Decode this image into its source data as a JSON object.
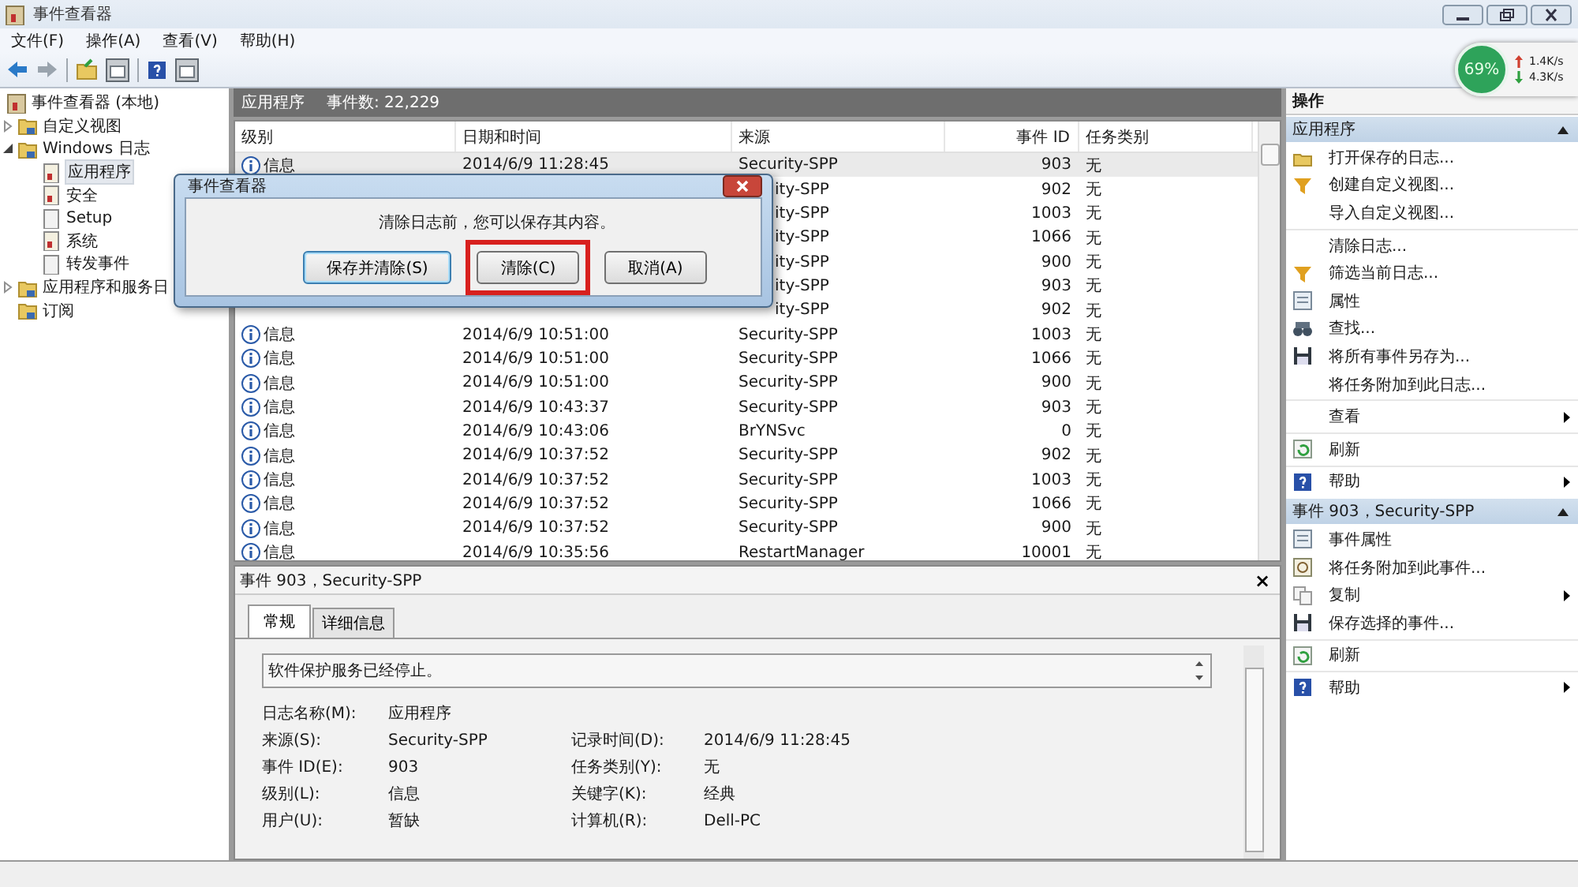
{
  "window": {
    "title": "事件查看器"
  },
  "menu": [
    "文件(F)",
    "操作(A)",
    "查看(V)",
    "帮助(H)"
  ],
  "network_widget": {
    "percent": "69%",
    "upload": "1.4K/s",
    "download": "4.3K/s"
  },
  "tree": [
    {
      "label": "事件查看器 (本地)",
      "kind": "root",
      "selected": false,
      "children": [
        {
          "label": "自定义视图",
          "kind": "folder",
          "selected": false,
          "expanded": false
        },
        {
          "label": "Windows 日志",
          "kind": "folder",
          "selected": false,
          "expanded": true,
          "children": [
            {
              "label": "应用程序",
              "kind": "log",
              "selected": true
            },
            {
              "label": "安全",
              "kind": "log",
              "selected": false
            },
            {
              "label": "Setup",
              "kind": "plain",
              "selected": false
            },
            {
              "label": "系统",
              "kind": "log",
              "selected": false
            },
            {
              "label": "转发事件",
              "kind": "plain",
              "selected": false
            }
          ]
        },
        {
          "label": "应用程序和服务日",
          "kind": "folder",
          "selected": false,
          "expanded": false
        },
        {
          "label": "订阅",
          "kind": "folder",
          "selected": false
        }
      ]
    }
  ],
  "log_header": {
    "name": "应用程序",
    "count": "事件数: 22,229"
  },
  "table": {
    "columns": [
      "级别",
      "日期和时间",
      "来源",
      "事件 ID",
      "任务类别"
    ],
    "rows": [
      {
        "level": "信息",
        "date": "2014/6/9 11:28:45",
        "source": "Security-SPP",
        "id": "903",
        "task": "无",
        "selected": true
      },
      {
        "source": "ity-SPP",
        "id": "902",
        "task": "无",
        "selected": false
      },
      {
        "source": "ity-SPP",
        "id": "1003",
        "task": "无",
        "selected": false
      },
      {
        "source": "ity-SPP",
        "id": "1066",
        "task": "无",
        "selected": false
      },
      {
        "source": "ity-SPP",
        "id": "900",
        "task": "无",
        "selected": false
      },
      {
        "source": "ity-SPP",
        "id": "903",
        "task": "无",
        "selected": false
      },
      {
        "source": "ity-SPP",
        "id": "902",
        "task": "无",
        "selected": false
      },
      {
        "level": "信息",
        "date": "2014/6/9 10:51:00",
        "source": "Security-SPP",
        "id": "1003",
        "task": "无",
        "selected": false
      },
      {
        "level": "信息",
        "date": "2014/6/9 10:51:00",
        "source": "Security-SPP",
        "id": "1066",
        "task": "无",
        "selected": false
      },
      {
        "level": "信息",
        "date": "2014/6/9 10:51:00",
        "source": "Security-SPP",
        "id": "900",
        "task": "无",
        "selected": false
      },
      {
        "level": "信息",
        "date": "2014/6/9 10:43:37",
        "source": "Security-SPP",
        "id": "903",
        "task": "无",
        "selected": false
      },
      {
        "level": "信息",
        "date": "2014/6/9 10:43:06",
        "source": "BrYNSvc",
        "id": "0",
        "task": "无",
        "selected": false
      },
      {
        "level": "信息",
        "date": "2014/6/9 10:37:52",
        "source": "Security-SPP",
        "id": "902",
        "task": "无",
        "selected": false
      },
      {
        "level": "信息",
        "date": "2014/6/9 10:37:52",
        "source": "Security-SPP",
        "id": "1003",
        "task": "无",
        "selected": false
      },
      {
        "level": "信息",
        "date": "2014/6/9 10:37:52",
        "source": "Security-SPP",
        "id": "1066",
        "task": "无",
        "selected": false
      },
      {
        "level": "信息",
        "date": "2014/6/9 10:37:52",
        "source": "Security-SPP",
        "id": "900",
        "task": "无",
        "selected": false
      },
      {
        "level": "信息",
        "date": "2014/6/9 10:35:56",
        "source": "RestartManager",
        "id": "10001",
        "task": "无",
        "selected": false
      }
    ]
  },
  "detail": {
    "title": "事件 903，Security-SPP",
    "close": "×",
    "tabs": [
      {
        "label": "常规",
        "selected": true
      },
      {
        "label": "详细信息",
        "selected": false
      }
    ],
    "message": "软件保护服务已经停止。",
    "fields": [
      [
        {
          "label": "日志名称(M):",
          "value": "应用程序"
        }
      ],
      [
        {
          "label": "来源(S):",
          "value": "Security-SPP"
        },
        {
          "label": "记录时间(D):",
          "value": "2014/6/9 11:28:45"
        }
      ],
      [
        {
          "label": "事件 ID(E):",
          "value": "903"
        },
        {
          "label": "任务类别(Y):",
          "value": "无"
        }
      ],
      [
        {
          "label": "级别(L):",
          "value": "信息"
        },
        {
          "label": "关键字(K):",
          "value": "经典"
        }
      ],
      [
        {
          "label": "用户(U):",
          "value": "暂缺"
        },
        {
          "label": "计算机(R):",
          "value": "Dell-PC"
        }
      ]
    ]
  },
  "actions": {
    "title": "操作",
    "sections": [
      {
        "title": "应用程序",
        "groups": [
          [
            {
              "label": "打开保存的日志...",
              "kind": "open",
              "submenu": false
            },
            {
              "label": "创建自定义视图...",
              "kind": "filter",
              "submenu": false
            },
            {
              "label": "导入自定义视图...",
              "kind": "none",
              "submenu": false
            }
          ],
          [
            {
              "label": "清除日志...",
              "kind": "none",
              "submenu": false
            },
            {
              "label": "筛选当前日志...",
              "kind": "filter",
              "submenu": false
            },
            {
              "label": "属性",
              "kind": "properties",
              "submenu": false
            },
            {
              "label": "查找...",
              "kind": "find",
              "submenu": false
            },
            {
              "label": "将所有事件另存为...",
              "kind": "save",
              "submenu": false
            },
            {
              "label": "将任务附加到此日志...",
              "kind": "none",
              "submenu": false
            }
          ],
          [
            {
              "label": "查看",
              "kind": "none",
              "submenu": true
            }
          ],
          [
            {
              "label": "刷新",
              "kind": "refresh",
              "submenu": false
            }
          ],
          [
            {
              "label": "帮助",
              "kind": "help",
              "submenu": true
            }
          ]
        ]
      },
      {
        "title": "事件 903，Security-SPP",
        "groups": [
          [
            {
              "label": "事件属性",
              "kind": "properties",
              "submenu": false
            },
            {
              "label": "将任务附加到此事件...",
              "kind": "attach",
              "submenu": false
            },
            {
              "label": "复制",
              "kind": "copy",
              "submenu": true
            },
            {
              "label": "保存选择的事件...",
              "kind": "save",
              "submenu": false
            }
          ],
          [
            {
              "label": "刷新",
              "kind": "refresh",
              "submenu": false
            }
          ],
          [
            {
              "label": "帮助",
              "kind": "help",
              "submenu": true
            }
          ]
        ]
      }
    ]
  },
  "dialog": {
    "title": "事件查看器",
    "message": "清除日志前，您可以保存其内容。",
    "buttons": [
      {
        "label": "保存并清除(S)",
        "highlighted": false
      },
      {
        "label": "清除(C)",
        "highlighted": true
      },
      {
        "label": "取消(A)",
        "highlighted": false
      }
    ]
  }
}
